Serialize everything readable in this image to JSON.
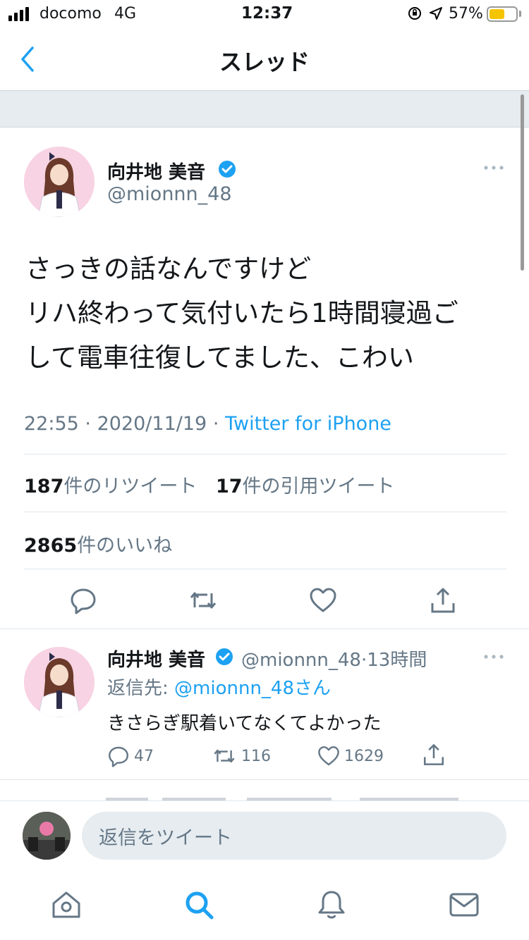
{
  "status_bar": {
    "carrier": "docomo",
    "network": "4G",
    "time": "12:37",
    "battery_percent": "57%",
    "battery_level": 0.57,
    "battery_color": "#f5c400"
  },
  "nav": {
    "title": "スレッド",
    "back_icon": "chevron-left-icon"
  },
  "main_tweet": {
    "author_name": "向井地 美音",
    "handle": "@mionnn_48",
    "verified": true,
    "text": "さっきの話なんですけど\nリハ終わって気付いたら1時間寝過ご\nして電車往復してました、こわい",
    "time": "22:55",
    "date": "2020/11/19",
    "separator": "·",
    "source": "Twitter for iPhone",
    "retweets_count": "187",
    "retweets_label": "件のリツイート",
    "quotes_count": "17",
    "quotes_label": "件の引用ツイート",
    "likes_count": "2865",
    "likes_label": "件のいいね"
  },
  "reply_tweet": {
    "author_name": "向井地 美音",
    "handle": "@mionnn_48",
    "time_ago": "13時間",
    "separator": "·",
    "reply_to_label": "返信先: ",
    "reply_to_handle": "@mionnn_48さん",
    "text": "きさらぎ駅着いてなくてよかった",
    "reply_count": "47",
    "retweet_count": "116",
    "like_count": "1629"
  },
  "compose": {
    "placeholder": "返信をツイート"
  },
  "tabs": [
    "home-icon",
    "search-icon",
    "notifications-icon",
    "messages-icon"
  ],
  "colors": {
    "accent": "#1da1f2",
    "secondary_text": "#657786",
    "divider": "#e1e8ed"
  }
}
